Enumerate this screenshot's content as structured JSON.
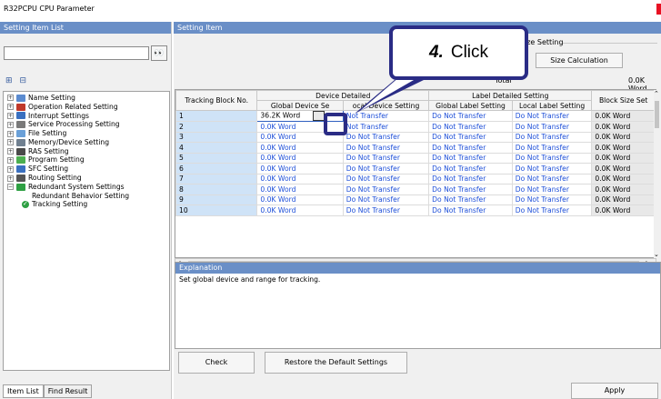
{
  "window": {
    "title": "R32PCPU CPU Parameter"
  },
  "left_panel": {
    "header": "Setting Item List",
    "search": {
      "value": "",
      "placeholder": ""
    },
    "tree": [
      {
        "label": "Name Setting",
        "icon": "name-icon",
        "color": "#5b8bd0"
      },
      {
        "label": "Operation Related Setting",
        "icon": "operation-icon",
        "color": "#c0392b"
      },
      {
        "label": "Interrupt Settings",
        "icon": "interrupt-icon",
        "color": "#3a70c0"
      },
      {
        "label": "Service Processing Setting",
        "icon": "service-icon",
        "color": "#7a7a7a"
      },
      {
        "label": "File Setting",
        "icon": "file-icon",
        "color": "#6aa0d8"
      },
      {
        "label": "Memory/Device Setting",
        "icon": "memory-icon",
        "color": "#708090"
      },
      {
        "label": "RAS Setting",
        "icon": "ras-icon",
        "color": "#4a4a4a"
      },
      {
        "label": "Program Setting",
        "icon": "program-icon",
        "color": "#4caf50"
      },
      {
        "label": "SFC Setting",
        "icon": "sfc-icon",
        "color": "#3a70c0"
      },
      {
        "label": "Routing Setting",
        "icon": "routing-icon",
        "color": "#555"
      },
      {
        "label": "Redundant System Settings",
        "icon": "redundant-icon",
        "color": "#2ea043"
      }
    ],
    "tree_children": [
      {
        "label": "Redundant Behavior Setting"
      },
      {
        "label": "Tracking Setting"
      }
    ],
    "tabs": [
      "Item List",
      "Find Result"
    ]
  },
  "right_panel": {
    "header": "Setting Item",
    "size_setting_label": "ize Setting",
    "size_calc_button": "Size Calculation",
    "total_label": "Total",
    "total_value": "0.0K Word",
    "columns": {
      "tracking_block_no": "Tracking Block No.",
      "device_detailed": "Device Detailed",
      "global_device": "Global Device Se",
      "local_device": "ocal Device Setting",
      "label_detailed": "Label Detailed Setting",
      "global_label": "Global Label Setting",
      "local_label": "Local Label Setting",
      "block_size": "Block Size Set"
    },
    "rows": [
      {
        "no": "1",
        "global_device": "36.2K Word",
        "local_device": "Not Transfer",
        "global_label": "Do Not Transfer",
        "local_label": "Do Not Transfer",
        "block_size": "0.0K Word"
      },
      {
        "no": "2",
        "global_device": "0.0K Word",
        "local_device": "Not Transfer",
        "global_label": "Do Not Transfer",
        "local_label": "Do Not Transfer",
        "block_size": "0.0K Word"
      },
      {
        "no": "3",
        "global_device": "0.0K Word",
        "local_device": "Do Not Transfer",
        "global_label": "Do Not Transfer",
        "local_label": "Do Not Transfer",
        "block_size": "0.0K Word"
      },
      {
        "no": "4",
        "global_device": "0.0K Word",
        "local_device": "Do Not Transfer",
        "global_label": "Do Not Transfer",
        "local_label": "Do Not Transfer",
        "block_size": "0.0K Word"
      },
      {
        "no": "5",
        "global_device": "0.0K Word",
        "local_device": "Do Not Transfer",
        "global_label": "Do Not Transfer",
        "local_label": "Do Not Transfer",
        "block_size": "0.0K Word"
      },
      {
        "no": "6",
        "global_device": "0.0K Word",
        "local_device": "Do Not Transfer",
        "global_label": "Do Not Transfer",
        "local_label": "Do Not Transfer",
        "block_size": "0.0K Word"
      },
      {
        "no": "7",
        "global_device": "0.0K Word",
        "local_device": "Do Not Transfer",
        "global_label": "Do Not Transfer",
        "local_label": "Do Not Transfer",
        "block_size": "0.0K Word"
      },
      {
        "no": "8",
        "global_device": "0.0K Word",
        "local_device": "Do Not Transfer",
        "global_label": "Do Not Transfer",
        "local_label": "Do Not Transfer",
        "block_size": "0.0K Word"
      },
      {
        "no": "9",
        "global_device": "0.0K Word",
        "local_device": "Do Not Transfer",
        "global_label": "Do Not Transfer",
        "local_label": "Do Not Transfer",
        "block_size": "0.0K Word"
      },
      {
        "no": "10",
        "global_device": "0.0K Word",
        "local_device": "Do Not Transfer",
        "global_label": "Do Not Transfer",
        "local_label": "Do Not Transfer",
        "block_size": "0.0K Word"
      }
    ],
    "explanation_header": "Explanation",
    "explanation_text": "Set global device and range for tracking.",
    "check_button": "Check",
    "restore_button": "Restore the Default Settings",
    "apply_button": "Apply"
  },
  "callout": {
    "step": "4.",
    "text": "Click"
  },
  "colors": {
    "header_blue": "#6a8fc7",
    "callout_navy": "#2a2c85",
    "link_blue": "#1c4ed8"
  }
}
